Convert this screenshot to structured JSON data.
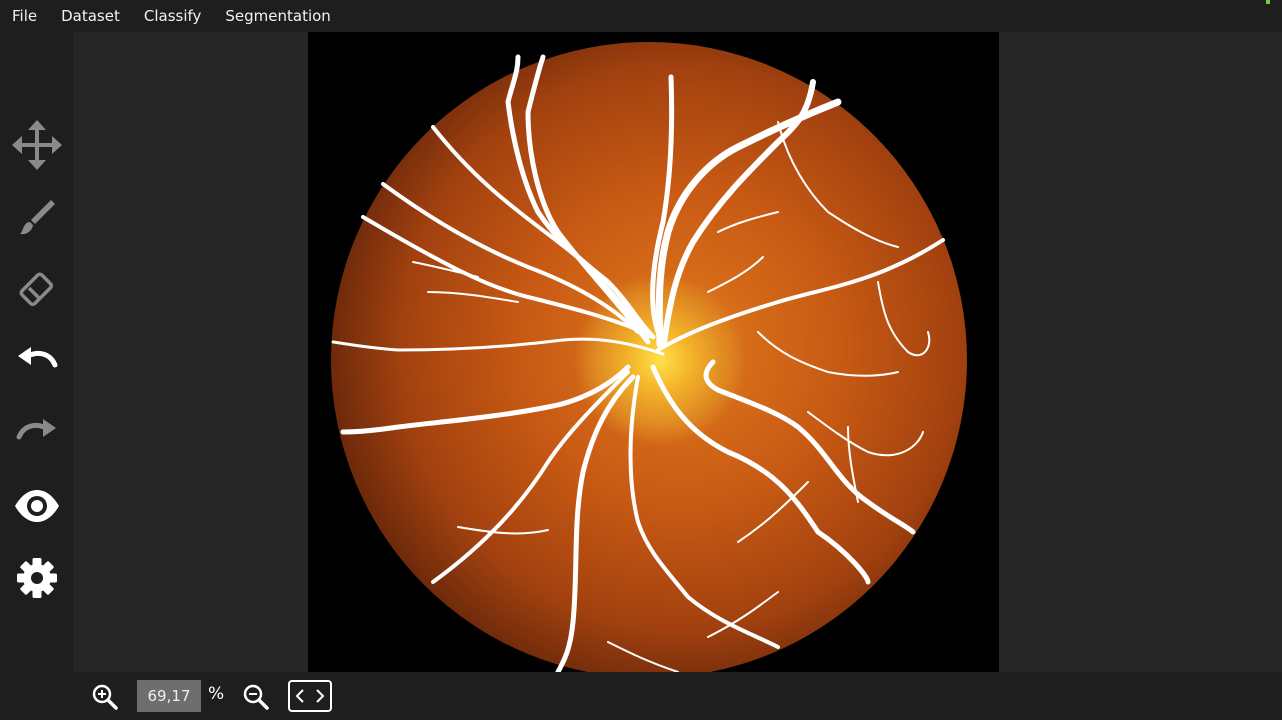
{
  "menu": {
    "items": [
      "File",
      "Dataset",
      "Classify",
      "Segmentation"
    ]
  },
  "toolbar": {
    "tools": [
      {
        "name": "move",
        "icon": "move-icon",
        "active": false
      },
      {
        "name": "brush",
        "icon": "brush-icon",
        "active": false
      },
      {
        "name": "eraser",
        "icon": "eraser-icon",
        "active": false
      },
      {
        "name": "undo",
        "icon": "undo-icon",
        "active": true
      },
      {
        "name": "redo",
        "icon": "redo-icon",
        "active": false
      },
      {
        "name": "visibility",
        "icon": "eye-icon",
        "active": true
      },
      {
        "name": "settings",
        "icon": "gear-icon",
        "active": true
      }
    ]
  },
  "viewer": {
    "content": "retinal fundus image with white vessel segmentation overlay"
  },
  "zoom": {
    "value": "69,17",
    "unit": "%"
  },
  "colors": {
    "background": "#1e1e1e",
    "canvas": "#262626",
    "icon_dim": "#8a8a8a",
    "icon_active": "#ffffff",
    "zoom_field": "#6e6e6e",
    "accent_corner": "#7ac943"
  }
}
